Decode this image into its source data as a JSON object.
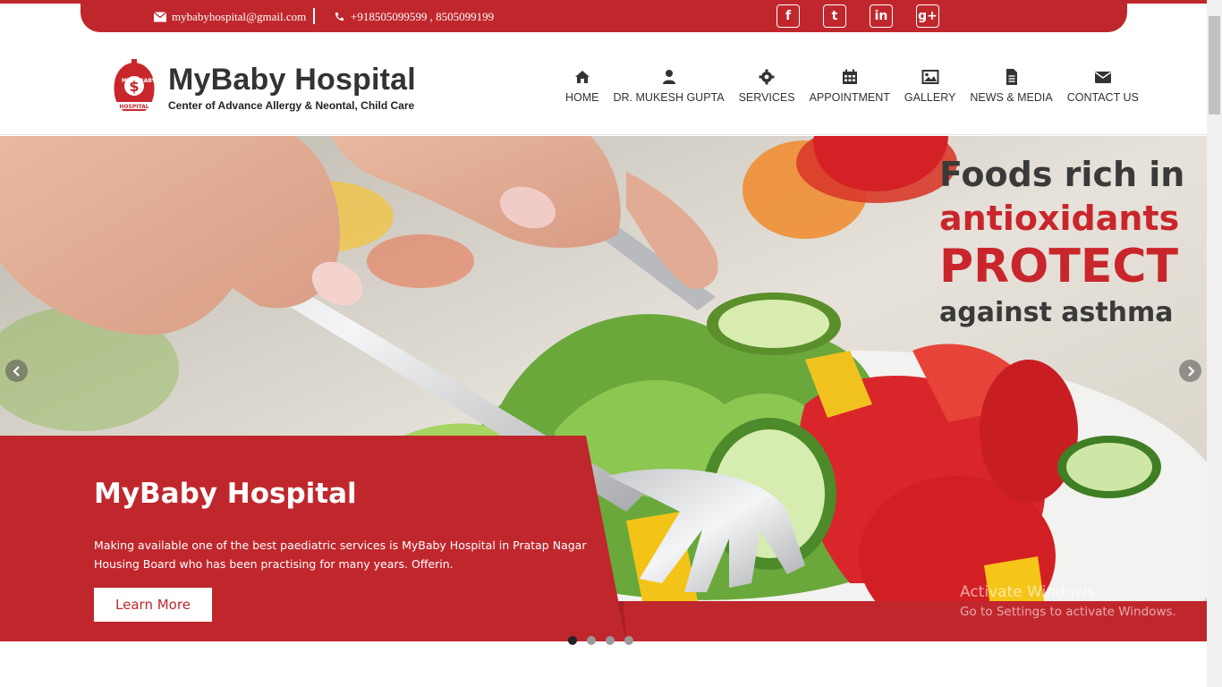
{
  "topbar": {
    "email": "mybabyhospital@gmail.com",
    "phone": "+918505099599 , 8505099199",
    "social": [
      "f",
      "t",
      "in",
      "g+"
    ]
  },
  "header": {
    "brand_name": "MyBaby Hospital",
    "tagline": "Center of Advance Allergy & Neontal, Child Care",
    "logo_text": "MY BABY HOSPITAL"
  },
  "nav": [
    {
      "label": "HOME",
      "icon": "home-icon"
    },
    {
      "label": "DR. MUKESH GUPTA",
      "icon": "user-icon"
    },
    {
      "label": "SERVICES",
      "icon": "gear-icon"
    },
    {
      "label": "APPOINTMENT",
      "icon": "calendar-icon"
    },
    {
      "label": "GALLERY",
      "icon": "image-icon"
    },
    {
      "label": "NEWS & MEDIA",
      "icon": "document-icon"
    },
    {
      "label": "CONTACT US",
      "icon": "envelope-icon"
    }
  ],
  "hero": {
    "headline_1": "Foods rich in",
    "headline_2": "antioxidants",
    "headline_3": "PROTECT",
    "headline_4": "against asthma",
    "caption_title": "MyBaby Hospital",
    "caption_text": "Making available one of the best paediatric services is MyBaby Hospital in Pratap Nagar Housing Board who has been practising for many years. Offerin.",
    "button_label": "Learn More",
    "slides": 4,
    "active_slide": 1
  },
  "watermark": {
    "line1": "Activate Windows",
    "line2": "Go to Settings to activate Windows."
  },
  "colors": {
    "brand_red": "#c0272d",
    "text_dark": "#333333"
  }
}
